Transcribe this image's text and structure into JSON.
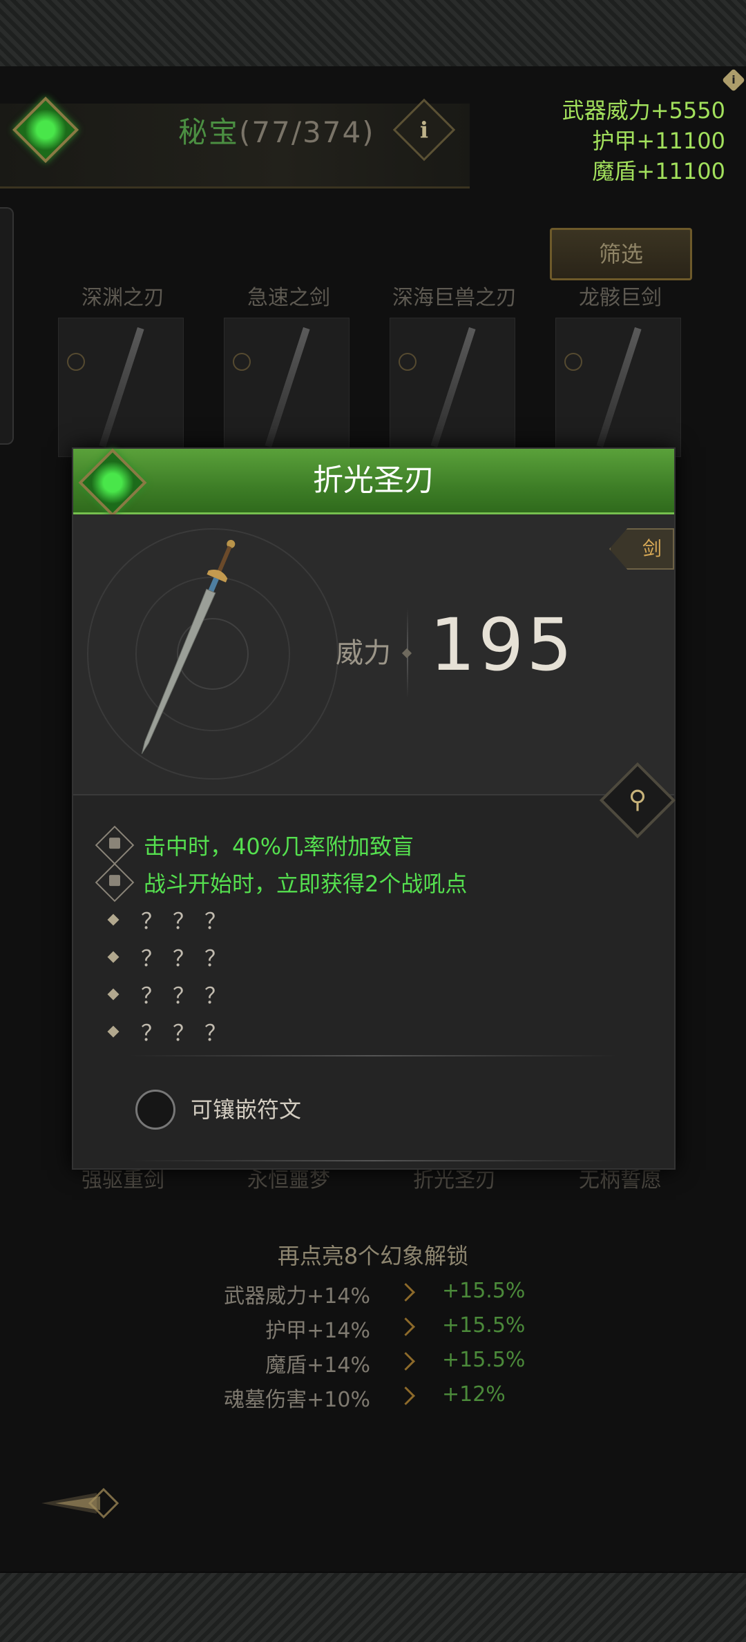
{
  "header": {
    "title": "秘宝",
    "count": "(77/374)",
    "info_icon": "i",
    "stats": [
      "武器威力+5550",
      "护甲+11100",
      "魔盾+11100"
    ]
  },
  "filter_label": "筛选",
  "grid_top_names": [
    "深渊之刃",
    "急速之剑",
    "深海巨兽之刃",
    "龙骸巨剑"
  ],
  "grid_bottom_names": [
    "强驱重剑",
    "永恒噩梦",
    "折光圣刃",
    "无柄誓愿"
  ],
  "modal": {
    "title": "折光圣刃",
    "type_tag": "剑",
    "power_label": "威力",
    "power_value": "195",
    "effects": [
      {
        "icon": "lock-icon",
        "text": "击中时，40%几率附加致盲"
      },
      {
        "icon": "lock-icon",
        "text": "战斗开始时，立即获得2个战吼点"
      },
      {
        "icon": "diamond-bullet-icon",
        "text": "？？？"
      },
      {
        "icon": "diamond-bullet-icon",
        "text": "？？？"
      },
      {
        "icon": "diamond-bullet-icon",
        "text": "？？？"
      },
      {
        "icon": "diamond-bullet-icon",
        "text": "？？？"
      }
    ],
    "rune_label": "可镶嵌符文",
    "zoom_icon": "magnifier-icon"
  },
  "unlock": {
    "title": "再点亮8个幻象解锁",
    "rows": [
      {
        "current": "武器威力+14%",
        "next": "+15.5%"
      },
      {
        "current": "护甲+14%",
        "next": "+15.5%"
      },
      {
        "current": "魔盾+14%",
        "next": "+15.5%"
      },
      {
        "current": "魂墓伤害+10%",
        "next": "+12%"
      }
    ]
  },
  "colors": {
    "accent_green": "#55e04f",
    "header_green": "#3e7e27",
    "gold": "#d7a956"
  }
}
